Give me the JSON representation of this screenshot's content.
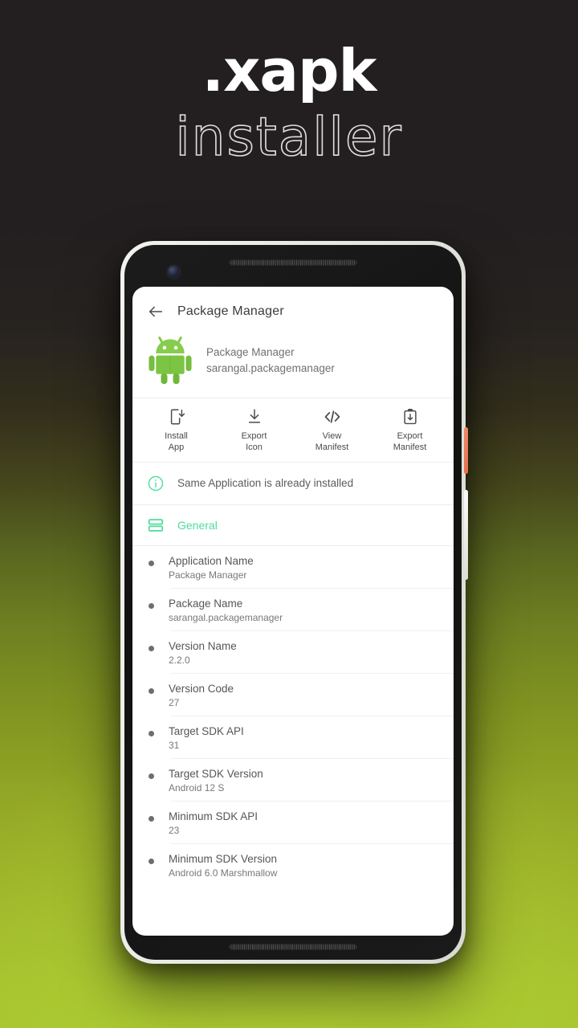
{
  "hero": {
    "title_main": ".xapk",
    "title_sub": "installer"
  },
  "phone": {
    "power_button": "power-button",
    "volume_button": "volume-rocker"
  },
  "screen": {
    "appbar": {
      "back_icon": "back-arrow-icon",
      "title": "Package Manager"
    },
    "app_header": {
      "icon": "android-robot-icon",
      "app_name": "Package Manager",
      "package_name": "sarangal.packagemanager"
    },
    "actions": [
      {
        "icon": "install-app-icon",
        "label": "Install\nApp"
      },
      {
        "icon": "export-icon-icon",
        "label": "Export\nIcon"
      },
      {
        "icon": "view-manifest-icon",
        "label": "View\nManifest"
      },
      {
        "icon": "export-manifest-icon",
        "label": "Export\nManifest"
      }
    ],
    "notice": {
      "icon": "info-icon",
      "text": "Same Application is already installed"
    },
    "section": {
      "icon": "list-rows-icon",
      "label": "General"
    },
    "details": [
      {
        "key": "Application Name",
        "value": "Package Manager"
      },
      {
        "key": "Package Name",
        "value": "sarangal.packagemanager"
      },
      {
        "key": "Version Name",
        "value": "2.2.0"
      },
      {
        "key": "Version Code",
        "value": "27"
      },
      {
        "key": "Target SDK API",
        "value": "31"
      },
      {
        "key": "Target SDK Version",
        "value": "Android 12 S"
      },
      {
        "key": "Minimum SDK API",
        "value": "23"
      },
      {
        "key": "Minimum SDK Version",
        "value": "Android 6.0 Marshmallow"
      }
    ]
  },
  "colors": {
    "accent_green": "#4ddc9a",
    "android_green": "#7fc742",
    "background_top": "#231f20",
    "background_bottom": "#a7c430",
    "power_button": "#e4714f"
  }
}
